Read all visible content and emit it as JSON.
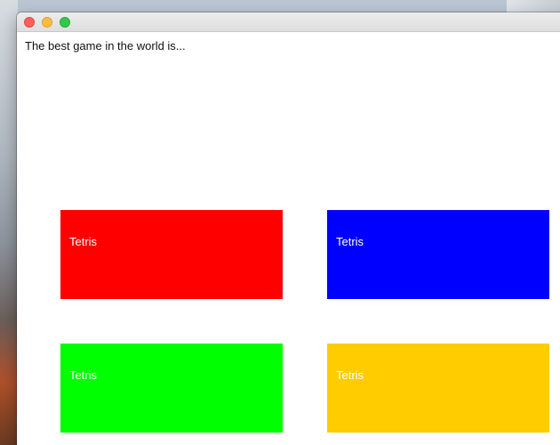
{
  "window": {
    "prompt": "The best game in the world is..."
  },
  "tiles": [
    {
      "label": "Tetris",
      "color": "#ff0000"
    },
    {
      "label": "Tetris",
      "color": "#0000ff"
    },
    {
      "label": "Tetris",
      "color": "#00ff00"
    },
    {
      "label": "Tetris",
      "color": "#ffcc00"
    }
  ],
  "traffic_lights": {
    "close": "#fc605c",
    "minimize": "#fdbc40",
    "zoom": "#34c84a"
  }
}
